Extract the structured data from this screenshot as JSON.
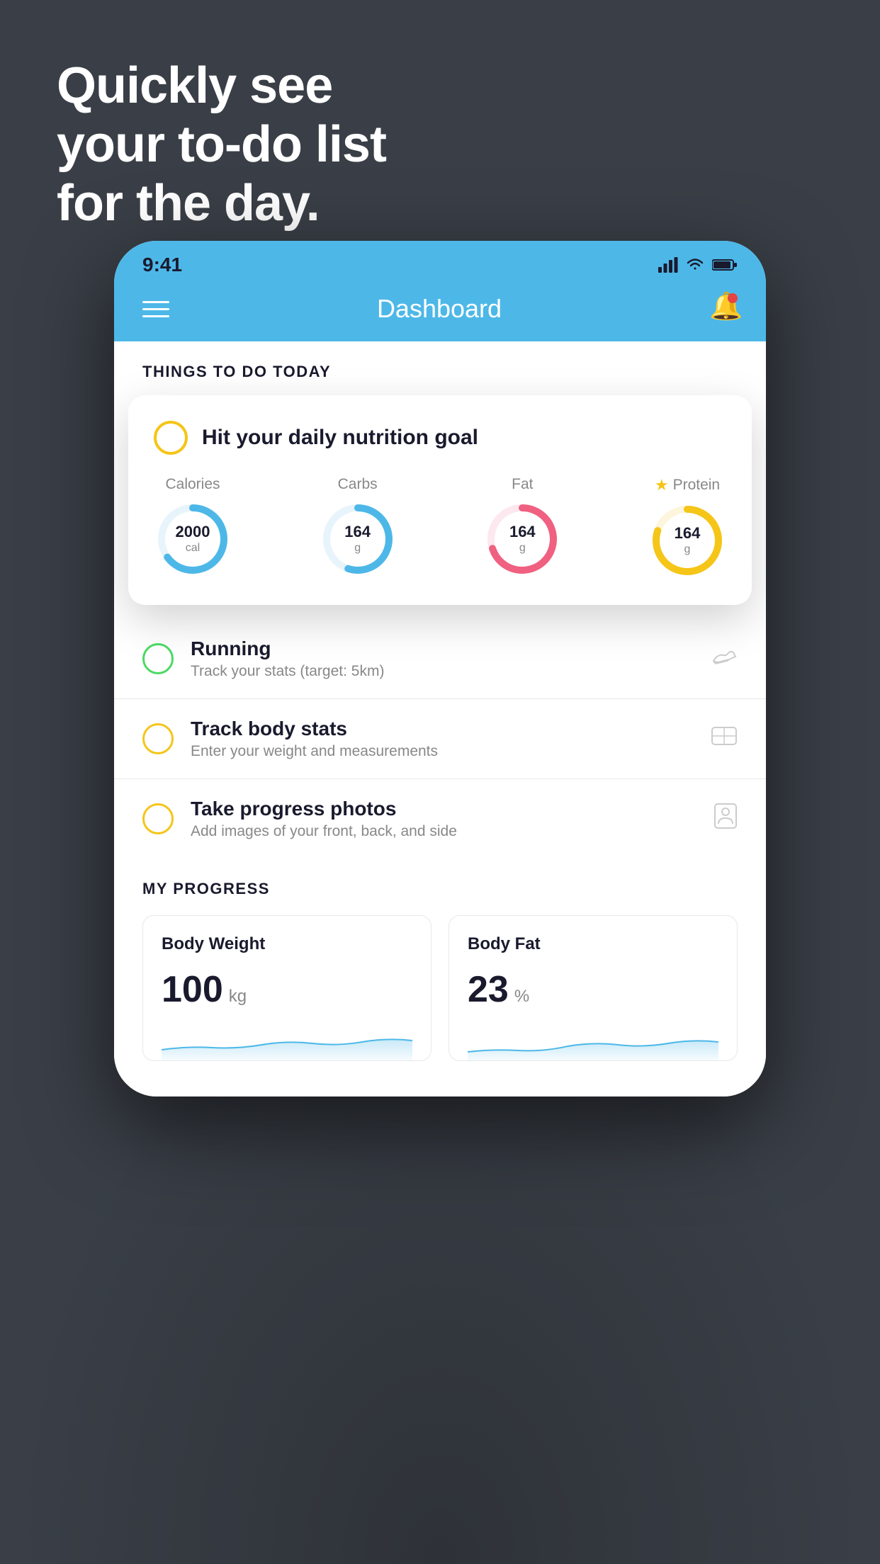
{
  "background": {
    "color": "#3a3f47"
  },
  "hero": {
    "line1": "Quickly see",
    "line2": "your to-do list",
    "line3": "for the day."
  },
  "phone": {
    "status_bar": {
      "time": "9:41",
      "signal_icon": "signal",
      "wifi_icon": "wifi",
      "battery_icon": "battery"
    },
    "header": {
      "menu_icon": "hamburger",
      "title": "Dashboard",
      "notification_icon": "bell"
    },
    "things_to_do": {
      "section_title": "THINGS TO DO TODAY",
      "featured_card": {
        "check_icon": "circle",
        "title": "Hit your daily nutrition goal",
        "nutrition_items": [
          {
            "label": "Calories",
            "value": "2000",
            "unit": "cal",
            "color": "#4db8e8",
            "percent": 65,
            "starred": false
          },
          {
            "label": "Carbs",
            "value": "164",
            "unit": "g",
            "color": "#4db8e8",
            "percent": 55,
            "starred": false
          },
          {
            "label": "Fat",
            "value": "164",
            "unit": "g",
            "color": "#f06080",
            "percent": 70,
            "starred": false
          },
          {
            "label": "Protein",
            "value": "164",
            "unit": "g",
            "color": "#f5c518",
            "percent": 80,
            "starred": true
          }
        ]
      },
      "list_items": [
        {
          "id": "running",
          "title": "Running",
          "subtitle": "Track your stats (target: 5km)",
          "circle_color": "green",
          "icon": "shoe"
        },
        {
          "id": "track-body-stats",
          "title": "Track body stats",
          "subtitle": "Enter your weight and measurements",
          "circle_color": "yellow",
          "icon": "scale"
        },
        {
          "id": "progress-photos",
          "title": "Take progress photos",
          "subtitle": "Add images of your front, back, and side",
          "circle_color": "yellow",
          "icon": "person"
        }
      ]
    },
    "my_progress": {
      "section_title": "MY PROGRESS",
      "cards": [
        {
          "id": "body-weight",
          "title": "Body Weight",
          "value": "100",
          "unit": "kg",
          "chart_color": "#4db8e8"
        },
        {
          "id": "body-fat",
          "title": "Body Fat",
          "value": "23",
          "unit": "%",
          "chart_color": "#4db8e8"
        }
      ]
    }
  }
}
